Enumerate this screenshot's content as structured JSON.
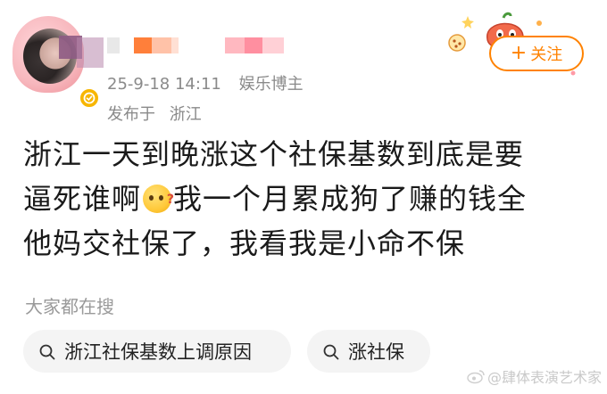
{
  "post": {
    "username_hidden": true,
    "timestamp": "25-9-18 14:11",
    "category": "娱乐博主",
    "location_prefix": "发布于",
    "location": "浙江",
    "follow_label": "关注",
    "follow_symbol": "+",
    "text_line_1": "浙江一天到晚涨这个社保基数到底是要",
    "text_line_2_a": "逼死谁啊",
    "text_line_2_b": "我一个月累成狗了赚的钱全",
    "text_line_3": "他妈交社保了，我看我是小命不保",
    "emoji_name": "thinking-face"
  },
  "searches": {
    "heading": "大家都在搜",
    "items": [
      {
        "label": "浙江社保基数上调原因"
      },
      {
        "label": "涨社保"
      }
    ]
  },
  "watermark": {
    "text": "@肆体表演艺术家"
  },
  "colors": {
    "accent": "#ff8200",
    "meta_text": "#8a8a8a",
    "verified": "#f7b600",
    "chip_bg": "#f4f4f4"
  },
  "icons": {
    "verified": "verified-badge-icon",
    "search": "search-icon",
    "follow_deco": "cartoon-decoration-icon",
    "watermark": "weibo-logo-icon"
  }
}
